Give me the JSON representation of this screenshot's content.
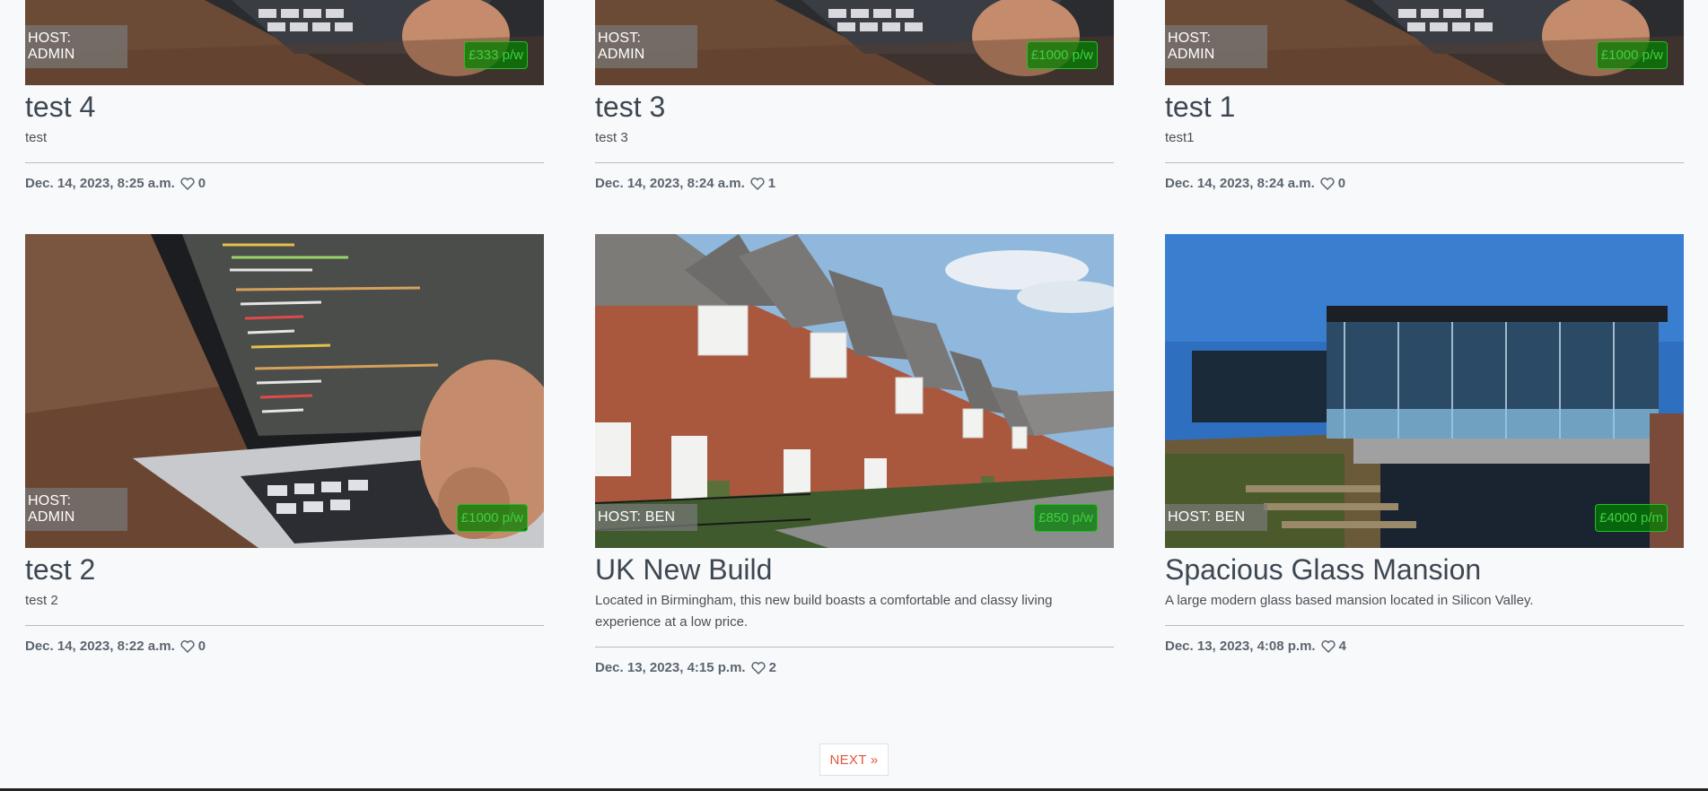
{
  "posts": [
    {
      "title": "test 4",
      "excerpt": "test",
      "host": "HOST: ADMIN",
      "price": "£333 p/w",
      "date": "Dec. 14, 2023, 8:25 a.m.",
      "likes": "0",
      "image": "laptop-code"
    },
    {
      "title": "test 3",
      "excerpt": "test 3",
      "host": "HOST: ADMIN",
      "price": "£1000 p/w",
      "date": "Dec. 14, 2023, 8:24 a.m.",
      "likes": "1",
      "image": "laptop-code"
    },
    {
      "title": "test 1",
      "excerpt": "test1",
      "host": "HOST: ADMIN",
      "price": "£1000 p/w",
      "date": "Dec. 14, 2023, 8:24 a.m.",
      "likes": "0",
      "image": "laptop-code"
    },
    {
      "title": "test 2",
      "excerpt": "test 2",
      "host": "HOST: ADMIN",
      "price": "£1000 p/w",
      "date": "Dec. 14, 2023, 8:22 a.m.",
      "likes": "0",
      "image": "laptop-code"
    },
    {
      "title": "UK New Build",
      "excerpt": "Located in Birmingham, this new build boasts a comfortable and classy living experience at a low price.",
      "host": "HOST: BEN",
      "price": "£850 p/w",
      "date": "Dec. 13, 2023, 4:15 p.m.",
      "likes": "2",
      "image": "terraced-houses"
    },
    {
      "title": "Spacious Glass Mansion",
      "excerpt": "A large modern glass based mansion located in Silicon Valley.",
      "host": "HOST: BEN",
      "price": "£4000 p/m",
      "date": "Dec. 13, 2023, 4:08 p.m.",
      "likes": "4",
      "image": "glass-mansion"
    }
  ],
  "pagination": {
    "next_label": "NEXT »"
  },
  "colors": {
    "accent": "#e2553f",
    "price_bg": "#1a8a1a",
    "price_text": "#3fd03f",
    "text": "#495057"
  }
}
